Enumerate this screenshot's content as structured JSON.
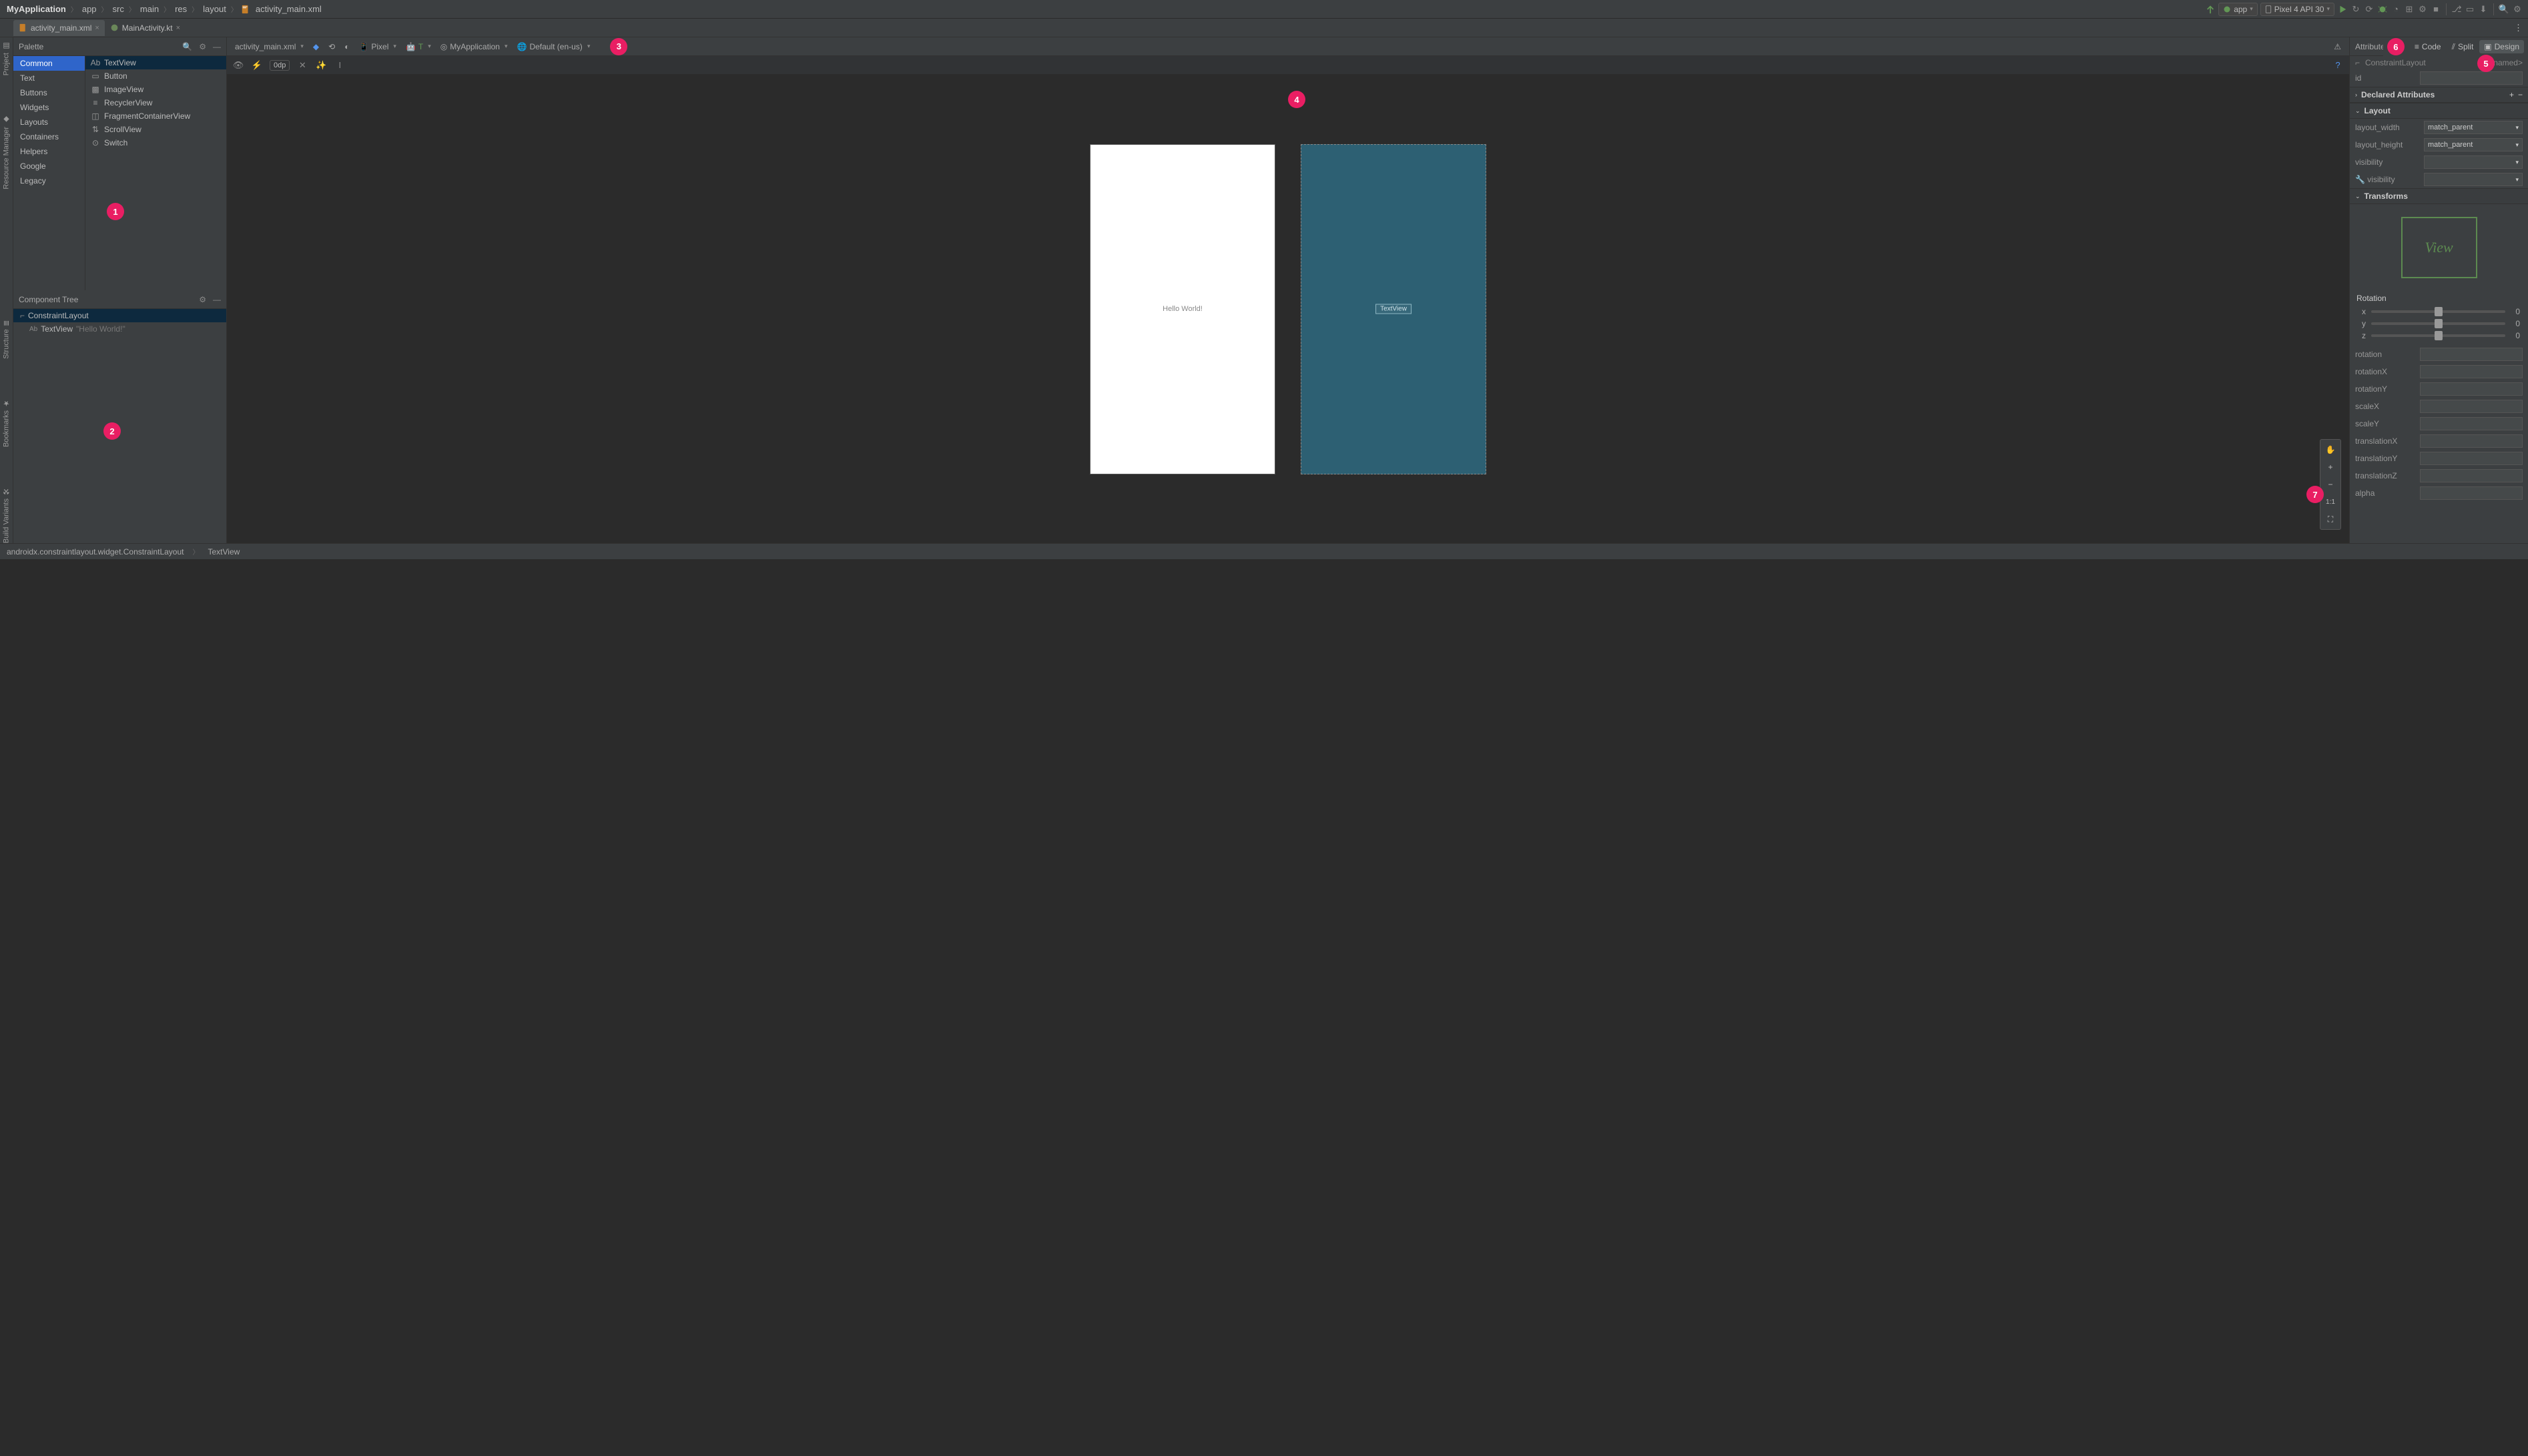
{
  "breadcrumbs": [
    "MyApplication",
    "app",
    "src",
    "main",
    "res",
    "layout",
    "activity_main.xml"
  ],
  "run_config": {
    "app": "app",
    "device": "Pixel 4 API 30"
  },
  "tabs": [
    {
      "name": "activity_main.xml",
      "active": true
    },
    {
      "name": "MainActivity.kt",
      "active": false
    }
  ],
  "view_modes": {
    "code": "Code",
    "split": "Split",
    "design": "Design",
    "active": "Design"
  },
  "palette": {
    "title": "Palette",
    "categories": [
      "Common",
      "Text",
      "Buttons",
      "Widgets",
      "Layouts",
      "Containers",
      "Helpers",
      "Google",
      "Legacy"
    ],
    "selected_category": "Common",
    "items": [
      "TextView",
      "Button",
      "ImageView",
      "RecyclerView",
      "FragmentContainerView",
      "ScrollView",
      "Switch"
    ],
    "selected_item": "TextView"
  },
  "component_tree": {
    "title": "Component Tree",
    "root": "ConstraintLayout",
    "children": [
      {
        "name": "TextView",
        "text": "\"Hello World!\""
      }
    ]
  },
  "design_toolbar": {
    "file": "activity_main.xml",
    "device": "Pixel",
    "api": "T",
    "theme": "MyApplication",
    "locale": "Default (en-us)",
    "margin": "0dp"
  },
  "canvas": {
    "hello": "Hello World!",
    "blueprint_label": "TextView"
  },
  "zoom": {
    "pan": "✋",
    "plus": "+",
    "minus": "−",
    "oneone": "1:1",
    "fit": "⛶"
  },
  "attributes": {
    "title": "Attributes",
    "component": "ConstraintLayout",
    "unnamed": "<unnamed>",
    "id_label": "id",
    "id_value": "",
    "declared": "Declared Attributes",
    "layout": "Layout",
    "layout_width_label": "layout_width",
    "layout_width": "match_parent",
    "layout_height_label": "layout_height",
    "layout_height": "match_parent",
    "visibility_label": "visibility",
    "visibility": "",
    "tools_visibility_label": "visibility",
    "transforms": "Transforms",
    "view_placeholder": "View",
    "rotation_header": "Rotation",
    "rotation_x": {
      "label": "x",
      "value": "0"
    },
    "rotation_y": {
      "label": "y",
      "value": "0"
    },
    "rotation_z": {
      "label": "z",
      "value": "0"
    },
    "fields": [
      "rotation",
      "rotationX",
      "rotationY",
      "scaleX",
      "scaleY",
      "translationX",
      "translationY",
      "translationZ",
      "alpha"
    ]
  },
  "left_rail": [
    "Project",
    "Resource Manager",
    "Structure",
    "Bookmarks",
    "Build Variants"
  ],
  "statusbar": {
    "path": "androidx.constraintlayout.widget.ConstraintLayout",
    "sub": "TextView"
  },
  "callouts": {
    "c1": "1",
    "c2": "2",
    "c3": "3",
    "c4": "4",
    "c5": "5",
    "c6": "6",
    "c7": "7"
  }
}
